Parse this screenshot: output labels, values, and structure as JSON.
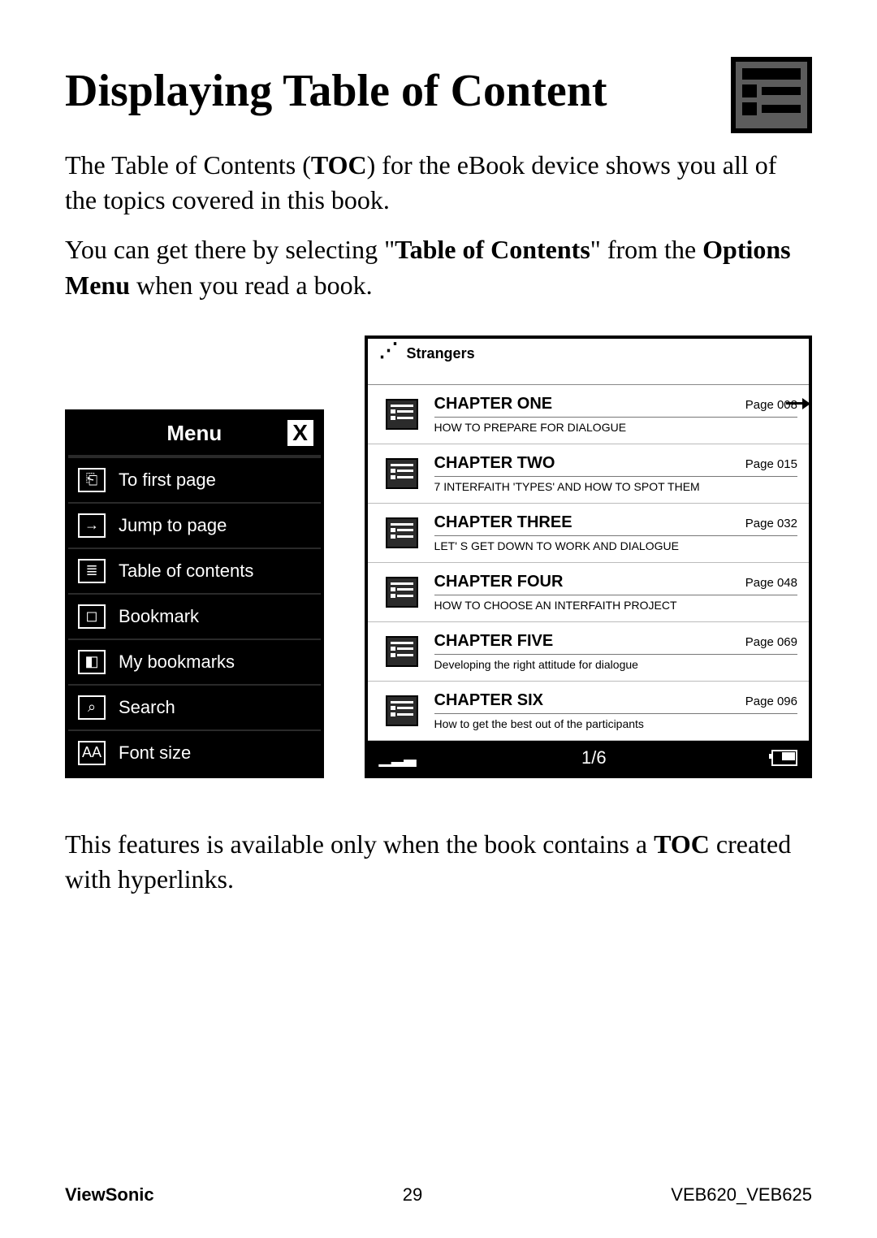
{
  "title": "Displaying Table of Content",
  "para1_a": "The Table of Contents (",
  "para1_b": "TOC",
  "para1_c": ") for the eBook device shows you all of the topics covered in this book.",
  "para2_a": "You can get there by selecting \"",
  "para2_b": "Table of Contents",
  "para2_c": "\" from the ",
  "para2_d": "Options Menu",
  "para2_e": " when you read a book.",
  "menu": {
    "title": "Menu",
    "close": "X",
    "items": [
      "To first page",
      "Jump to page",
      "Table of contents",
      "Bookmark",
      "My bookmarks",
      "Search",
      "Font size"
    ],
    "icons": [
      "firstpage-icon",
      "jump-icon",
      "toc-icon",
      "bookmark-icon",
      "mybookmarks-icon",
      "search-icon",
      "fontsize-icon"
    ],
    "iconglyph": [
      "⎗",
      "→",
      "≣",
      "◻",
      "◧",
      "⌕",
      "AA"
    ]
  },
  "toc": {
    "book_title": "Strangers",
    "chapters": [
      {
        "title": "CHAPTER ONE",
        "page": "Page 008",
        "sub": "HOW TO PREPARE FOR DIALOGUE"
      },
      {
        "title": "CHAPTER TWO",
        "page": "Page 015",
        "sub": "7 INTERFAITH 'TYPES' AND HOW TO SPOT THEM"
      },
      {
        "title": "CHAPTER THREE",
        "page": "Page 032",
        "sub": "LET' S GET DOWN TO WORK AND DIALOGUE"
      },
      {
        "title": "CHAPTER FOUR",
        "page": "Page 048",
        "sub": "HOW TO CHOOSE AN INTERFAITH PROJECT"
      },
      {
        "title": "CHAPTER FIVE",
        "page": "Page 069",
        "sub": "Developing the right attitude for dialogue"
      },
      {
        "title": "CHAPTER SIX",
        "page": "Page 096",
        "sub": "How to get the best out of the participants"
      }
    ],
    "page_indicator": "1/6"
  },
  "para3_a": "This features is available only when the book contains a ",
  "para3_b": "TOC",
  "para3_c": " created with hyperlinks.",
  "footer": {
    "brand": "ViewSonic",
    "page": "29",
    "model": "VEB620_VEB625"
  }
}
